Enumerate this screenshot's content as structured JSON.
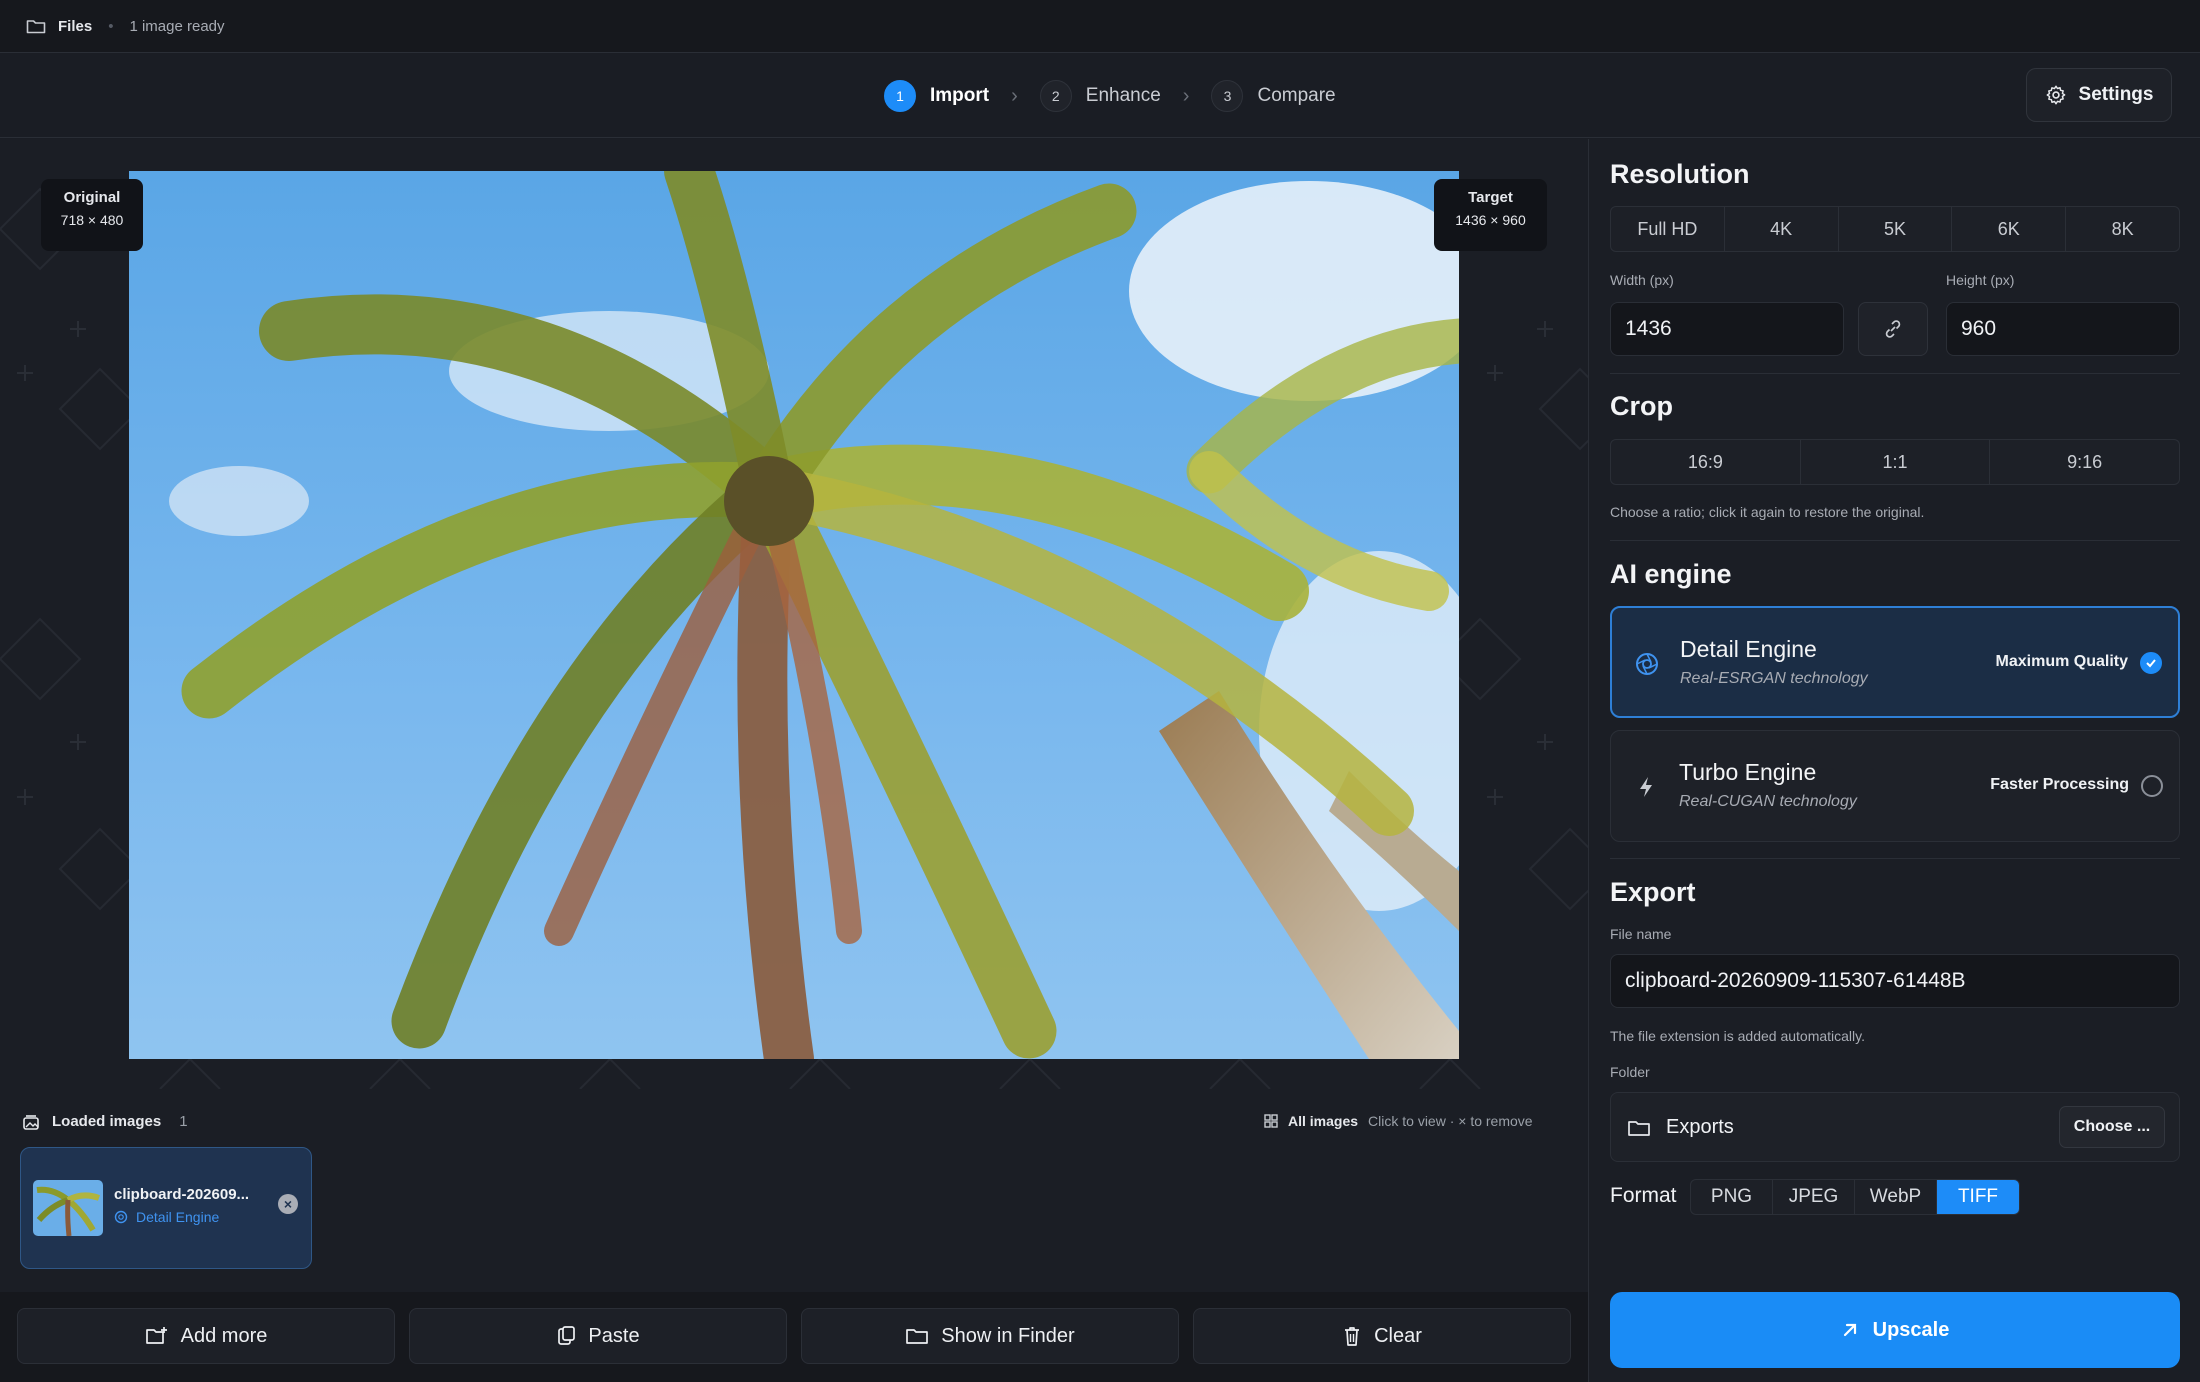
{
  "topbar": {
    "files_label": "Files",
    "separator": "•",
    "status": "1 image ready",
    "files_icon": "folder-icon"
  },
  "steps": [
    {
      "num": "1",
      "label": "Import",
      "active": true
    },
    {
      "num": "2",
      "label": "Enhance",
      "active": false
    },
    {
      "num": "3",
      "label": "Compare",
      "active": false
    }
  ],
  "settings": {
    "label": "Settings",
    "icon": "gear-icon"
  },
  "preview": {
    "original_title": "Original",
    "original_size": "718 × 480",
    "target_title": "Target",
    "target_size": "1436 × 960"
  },
  "loaded": {
    "title": "Loaded images",
    "count": "1",
    "all_images": "All images",
    "hint": "Click to view · × to remove",
    "items": [
      {
        "name": "clipboard-202609...",
        "engine": "Detail Engine"
      }
    ]
  },
  "actions": {
    "add_more": "Add more",
    "paste": "Paste",
    "show_in_finder": "Show in Finder",
    "clear": "Clear"
  },
  "resolution": {
    "title": "Resolution",
    "presets": [
      "Full HD",
      "4K",
      "5K",
      "6K",
      "8K"
    ],
    "width_label": "Width (px)",
    "width_value": "1436",
    "height_label": "Height (px)",
    "height_value": "960"
  },
  "crop": {
    "title": "Crop",
    "ratios": [
      "16:9",
      "1:1",
      "9:16"
    ],
    "hint": "Choose a ratio; click it again to restore the original."
  },
  "ai_engine": {
    "title": "AI engine",
    "engines": [
      {
        "name": "Detail Engine",
        "tech": "Real-ESRGAN technology",
        "tag": "Maximum Quality",
        "selected": true
      },
      {
        "name": "Turbo Engine",
        "tech": "Real-CUGAN technology",
        "tag": "Faster Processing",
        "selected": false
      }
    ]
  },
  "export": {
    "title": "Export",
    "file_name_label": "File name",
    "file_name": "clipboard-20260909-115307-61448B",
    "extension_hint": "The file extension is added automatically.",
    "folder_label": "Folder",
    "folder_name": "Exports",
    "choose_label": "Choose ...",
    "format_label": "Format",
    "formats": [
      "PNG",
      "JPEG",
      "WebP",
      "TIFF"
    ],
    "selected_format": "TIFF"
  },
  "upscale": {
    "label": "Upscale"
  },
  "colors": {
    "accent": "#1d8cf8",
    "background": "#1a1d24",
    "panel": "#1b1e25"
  }
}
